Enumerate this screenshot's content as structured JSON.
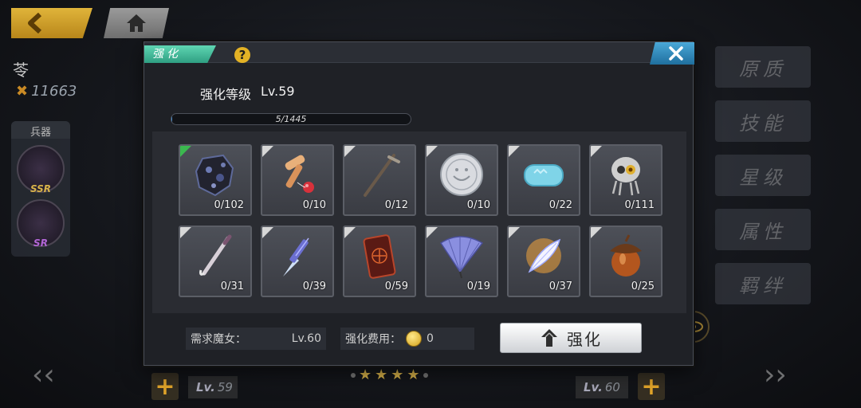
{
  "background": {
    "character_name": "苓",
    "power": "11663",
    "weapon_section_label": "兵器",
    "weapon_slots": [
      {
        "rank": "SSR"
      },
      {
        "rank": "SR"
      }
    ],
    "right_tabs": [
      "原质",
      "技能",
      "星级",
      "属性",
      "羁绊"
    ],
    "bottom": {
      "left_level": "59",
      "right_level": "60",
      "lv_prefix": "Lv."
    }
  },
  "dialog": {
    "title_tab": "强化",
    "level_label": "强化等级",
    "level_value": "Lv.59",
    "progress": {
      "text": "5/1445",
      "current": 5,
      "max": 1445
    },
    "items": [
      {
        "name": "ore",
        "count": "0/102",
        "marker": "green"
      },
      {
        "name": "kendama",
        "count": "0/10",
        "marker": "white"
      },
      {
        "name": "staff",
        "count": "0/12",
        "marker": "white"
      },
      {
        "name": "silver-coin",
        "count": "0/10",
        "marker": "white"
      },
      {
        "name": "soap",
        "count": "0/22",
        "marker": "white"
      },
      {
        "name": "skull",
        "count": "0/111",
        "marker": "white"
      },
      {
        "name": "brush",
        "count": "0/31",
        "marker": "white"
      },
      {
        "name": "butterfly-knife",
        "count": "0/39",
        "marker": "white"
      },
      {
        "name": "talisman-box",
        "count": "0/59",
        "marker": "white"
      },
      {
        "name": "folding-fan",
        "count": "0/19",
        "marker": "white"
      },
      {
        "name": "feather",
        "count": "0/37",
        "marker": "white"
      },
      {
        "name": "acorn",
        "count": "0/25",
        "marker": "white"
      }
    ],
    "requirement_label": "需求魔女：",
    "requirement_value": "Lv.60",
    "cost_label": "强化费用：",
    "cost_value": "0",
    "enhance_button_label": "强化"
  },
  "colors": {
    "accent_teal": "#3fbf9c",
    "close_blue": "#2f88bd",
    "gold": "#e3b225"
  }
}
